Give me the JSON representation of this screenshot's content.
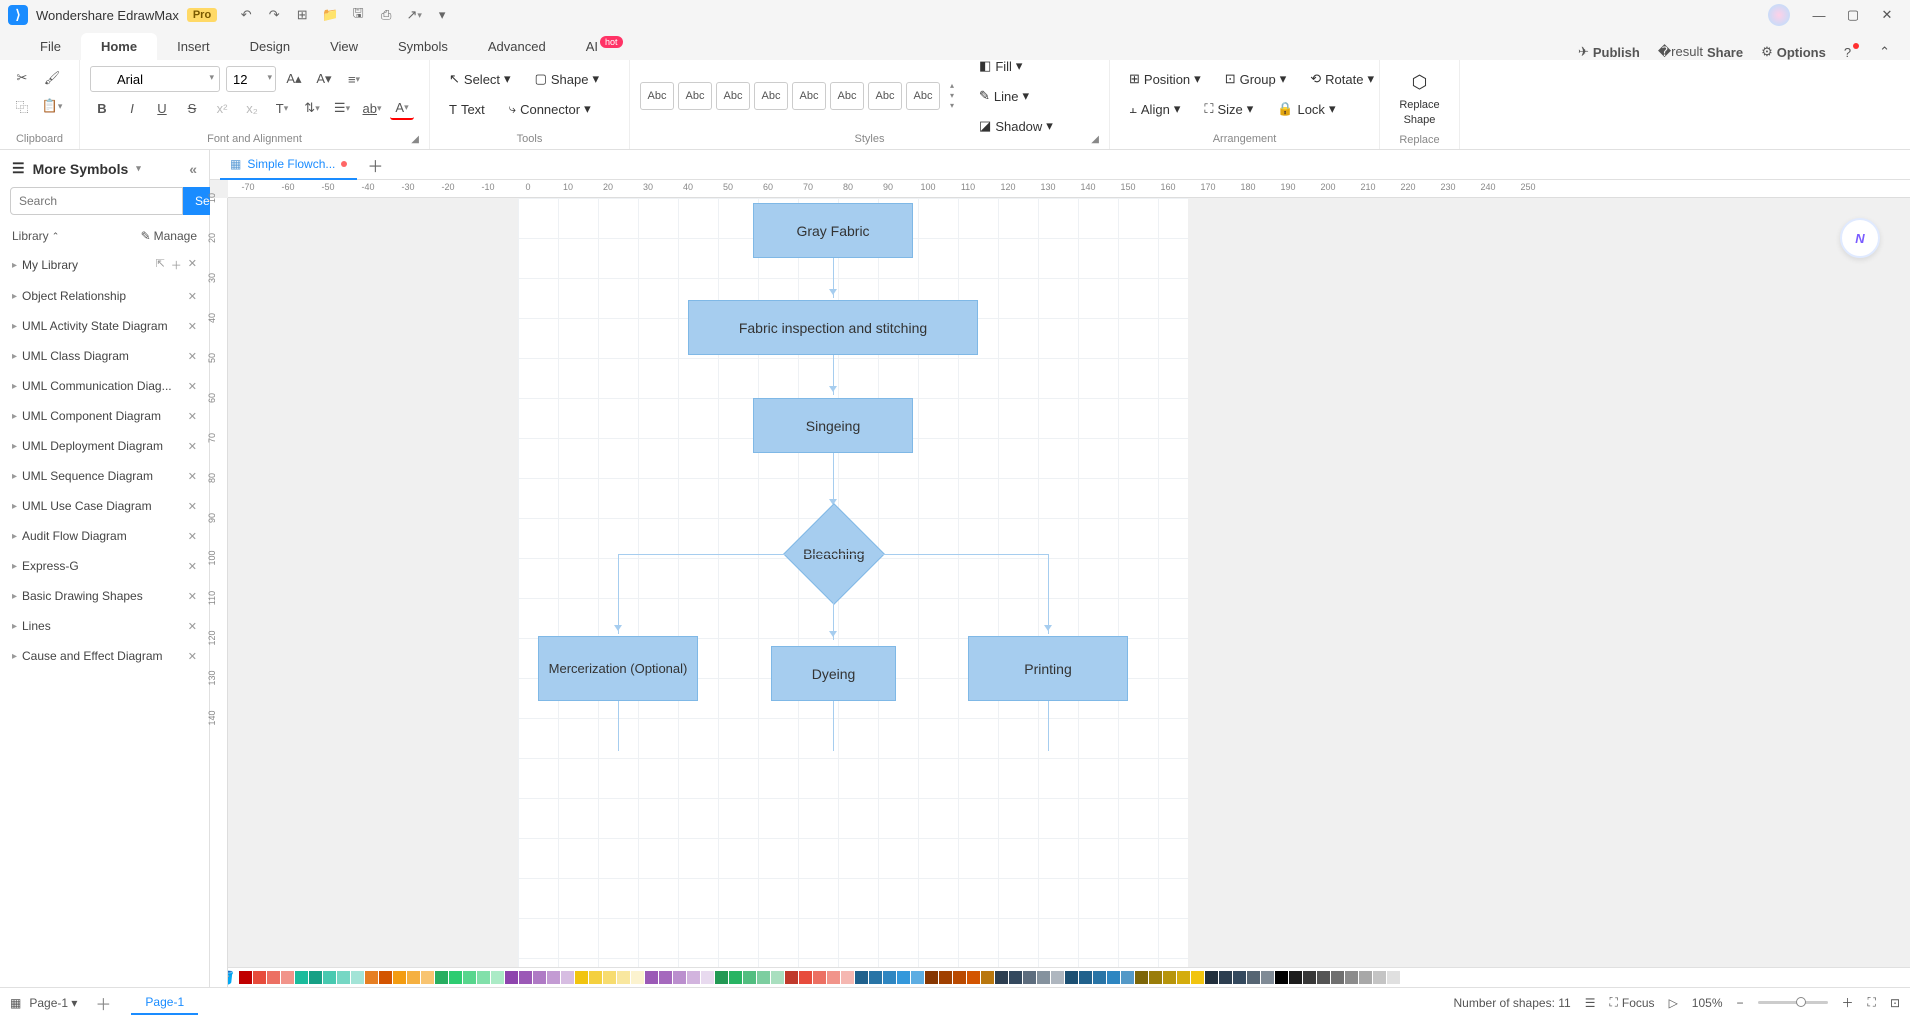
{
  "app": {
    "title": "Wondershare EdrawMax",
    "pro": "Pro"
  },
  "menu": {
    "tabs": [
      "File",
      "Home",
      "Insert",
      "Design",
      "View",
      "Symbols",
      "Advanced",
      "AI"
    ],
    "active": "Home",
    "ai_badge": "hot",
    "right": {
      "publish": "Publish",
      "share": "Share",
      "options": "Options"
    }
  },
  "ribbon": {
    "clipboard_label": "Clipboard",
    "font_label": "Font and Alignment",
    "font_name": "Arial",
    "font_size": "12",
    "tools_label": "Tools",
    "select": "Select",
    "shape": "Shape",
    "text": "Text",
    "connector": "Connector",
    "styles_label": "Styles",
    "style_preview": "Abc",
    "fill": "Fill",
    "line": "Line",
    "shadow": "Shadow",
    "arrangement_label": "Arrangement",
    "position": "Position",
    "group": "Group",
    "rotate": "Rotate",
    "align": "Align",
    "size": "Size",
    "lock": "Lock",
    "replace_shape": "Replace Shape",
    "replace_label": "Replace"
  },
  "left": {
    "title": "More Symbols",
    "search_placeholder": "Search",
    "search_btn": "Search",
    "library": "Library",
    "manage": "Manage",
    "items": [
      {
        "label": "My Library",
        "extra": true
      },
      {
        "label": "Object Relationship"
      },
      {
        "label": "UML Activity State Diagram"
      },
      {
        "label": "UML Class Diagram"
      },
      {
        "label": "UML Communication Diag..."
      },
      {
        "label": "UML Component Diagram"
      },
      {
        "label": "UML Deployment Diagram"
      },
      {
        "label": "UML Sequence Diagram"
      },
      {
        "label": "UML Use Case Diagram"
      },
      {
        "label": "Audit Flow Diagram"
      },
      {
        "label": "Express-G"
      },
      {
        "label": "Basic Drawing Shapes"
      },
      {
        "label": "Lines"
      },
      {
        "label": "Cause and Effect Diagram"
      }
    ]
  },
  "doc": {
    "tab": "Simple Flowch..."
  },
  "rulerH": [
    -70,
    -60,
    -50,
    -40,
    -30,
    -20,
    -10,
    0,
    10,
    20,
    30,
    40,
    50,
    60,
    70,
    80,
    90,
    100,
    110,
    120,
    130,
    140,
    150,
    160,
    170,
    180,
    190,
    200,
    210,
    220,
    230,
    240,
    250
  ],
  "rulerV": [
    10,
    20,
    30,
    40,
    50,
    60,
    70,
    80,
    90,
    100,
    110,
    120,
    130,
    140
  ],
  "flowchart": {
    "n1": "Gray Fabric",
    "n2": "Fabric inspection and stitching",
    "n3": "Singeing",
    "n4": "Bleaching",
    "n5": "Mercerization (Optional)",
    "n6": "Dyeing",
    "n7": "Printing"
  },
  "status": {
    "page_dropdown": "Page-1",
    "page_tab": "Page-1",
    "shape_count": "Number of shapes: 11",
    "focus": "Focus",
    "zoom": "105%"
  },
  "colors": [
    "#c00000",
    "#e74c3c",
    "#ec7063",
    "#f1948a",
    "#1abc9c",
    "#16a085",
    "#48c9b0",
    "#76d7c4",
    "#a3e4d7",
    "#e67e22",
    "#d35400",
    "#f39c12",
    "#f5b041",
    "#f8c471",
    "#27ae60",
    "#2ecc71",
    "#58d68d",
    "#82e0aa",
    "#abebc6",
    "#8e44ad",
    "#9b59b6",
    "#af7ac5",
    "#c39bd3",
    "#d7bde2",
    "#f1c40f",
    "#f4d03f",
    "#f7dc6f",
    "#f9e79f",
    "#fcf3cf",
    "#9b59b6",
    "#a569bd",
    "#bb8fce",
    "#d2b4de",
    "#e8daef",
    "#229954",
    "#28b463",
    "#52be80",
    "#7dcea0",
    "#a9dfbf",
    "#c0392b",
    "#e74c3c",
    "#ec7063",
    "#f1948a",
    "#f5b7b1",
    "#1f618d",
    "#2874a6",
    "#2e86c1",
    "#3498db",
    "#5dade2",
    "#873600",
    "#a04000",
    "#ba4a00",
    "#d35400",
    "#b9770e",
    "#2c3e50",
    "#34495e",
    "#5d6d7e",
    "#85929e",
    "#aeb6bf",
    "#1b4f72",
    "#21618c",
    "#2874a6",
    "#2e86c1",
    "#5499c7",
    "#7d6608",
    "#9a7d0a",
    "#b7950b",
    "#d4ac0d",
    "#f1c40f",
    "#212f3c",
    "#2c3e50",
    "#34495e",
    "#566573",
    "#808b96",
    "#000000",
    "#1c1c1c",
    "#383838",
    "#545454",
    "#707070",
    "#8c8c8c",
    "#a8a8a8",
    "#c4c4c4",
    "#e0e0e0",
    "#ffffff"
  ]
}
